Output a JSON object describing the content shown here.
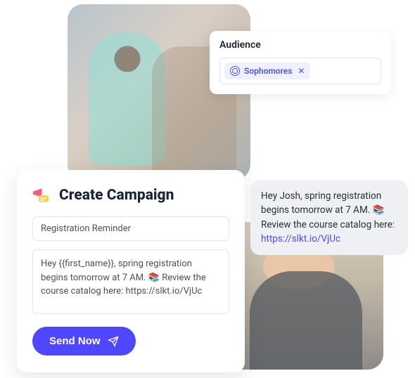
{
  "audience": {
    "label": "Audience",
    "tag": "Sophomores"
  },
  "campaign": {
    "title": "Create Campaign",
    "name_value": "Registration Reminder",
    "message_prefix": "Hey {{first_name}}, spring registration begins tomorrow at 7 AM. ",
    "message_suffix": " Review the course catalog here: https://slkt.io/VjUc",
    "send_label": "Send Now"
  },
  "preview": {
    "line1": "Hey Josh, spring registration begins tomorrow at 7 AM. ",
    "line2": " Review the course catalog here: ",
    "link": "https://slkt.io/VjUc"
  },
  "emoji": "📚"
}
